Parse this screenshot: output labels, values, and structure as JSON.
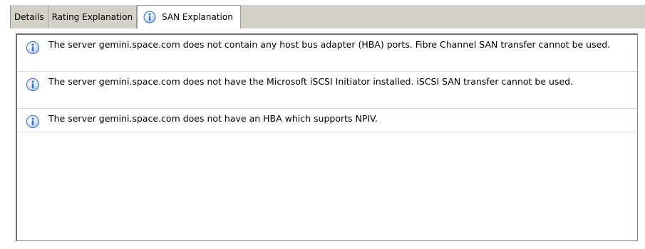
{
  "tabs": [
    {
      "label": "Details",
      "active": false
    },
    {
      "label": "Rating Explanation",
      "active": false
    },
    {
      "label": "SAN Explanation",
      "active": true,
      "icon": "info-icon"
    }
  ],
  "messages": [
    {
      "icon": "info-icon",
      "text": "The server gemini.space.com does not contain any host bus adapter (HBA) ports. Fibre Channel SAN transfer cannot be used."
    },
    {
      "icon": "info-icon",
      "text": "The server gemini.space.com does not have the Microsoft iSCSI Initiator installed. iSCSI SAN transfer cannot be used."
    },
    {
      "icon": "info-icon",
      "text": "The server gemini.space.com does not have an HBA which supports NPIV."
    }
  ],
  "colors": {
    "tab_bar": "#d4d0c8",
    "info_icon_fill": "#2f6fd0",
    "row_divider": "#dcdcdc"
  }
}
